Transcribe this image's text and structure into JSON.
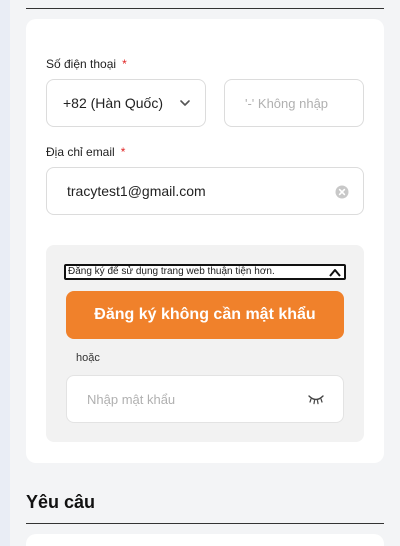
{
  "form": {
    "phone_label": "Số điện thoại",
    "required_mark": "*",
    "country_select_value": "+82 (Hàn Quốc)",
    "phone_placeholder": "'-' Không nhập",
    "email_label": "Địa chỉ email",
    "email_value": "tracytest1@gmail.com"
  },
  "passwordless": {
    "tooltip_text": "Đăng ký để sử dụng trang web thuận tiện hơn.",
    "cta_label": "Đăng ký không cần mật khẩu",
    "or_text": "hoặc",
    "password_placeholder": "Nhập mật khẩu"
  },
  "requests": {
    "title": "Yêu câu"
  },
  "colors": {
    "accent": "#f0812b",
    "required": "#e02424"
  },
  "icons": {
    "select_chevron": "chevron-down-icon",
    "clear": "clear-circle-icon",
    "tooltip_caret": "caret-up-icon",
    "password_toggle": "eye-closed-icon"
  }
}
